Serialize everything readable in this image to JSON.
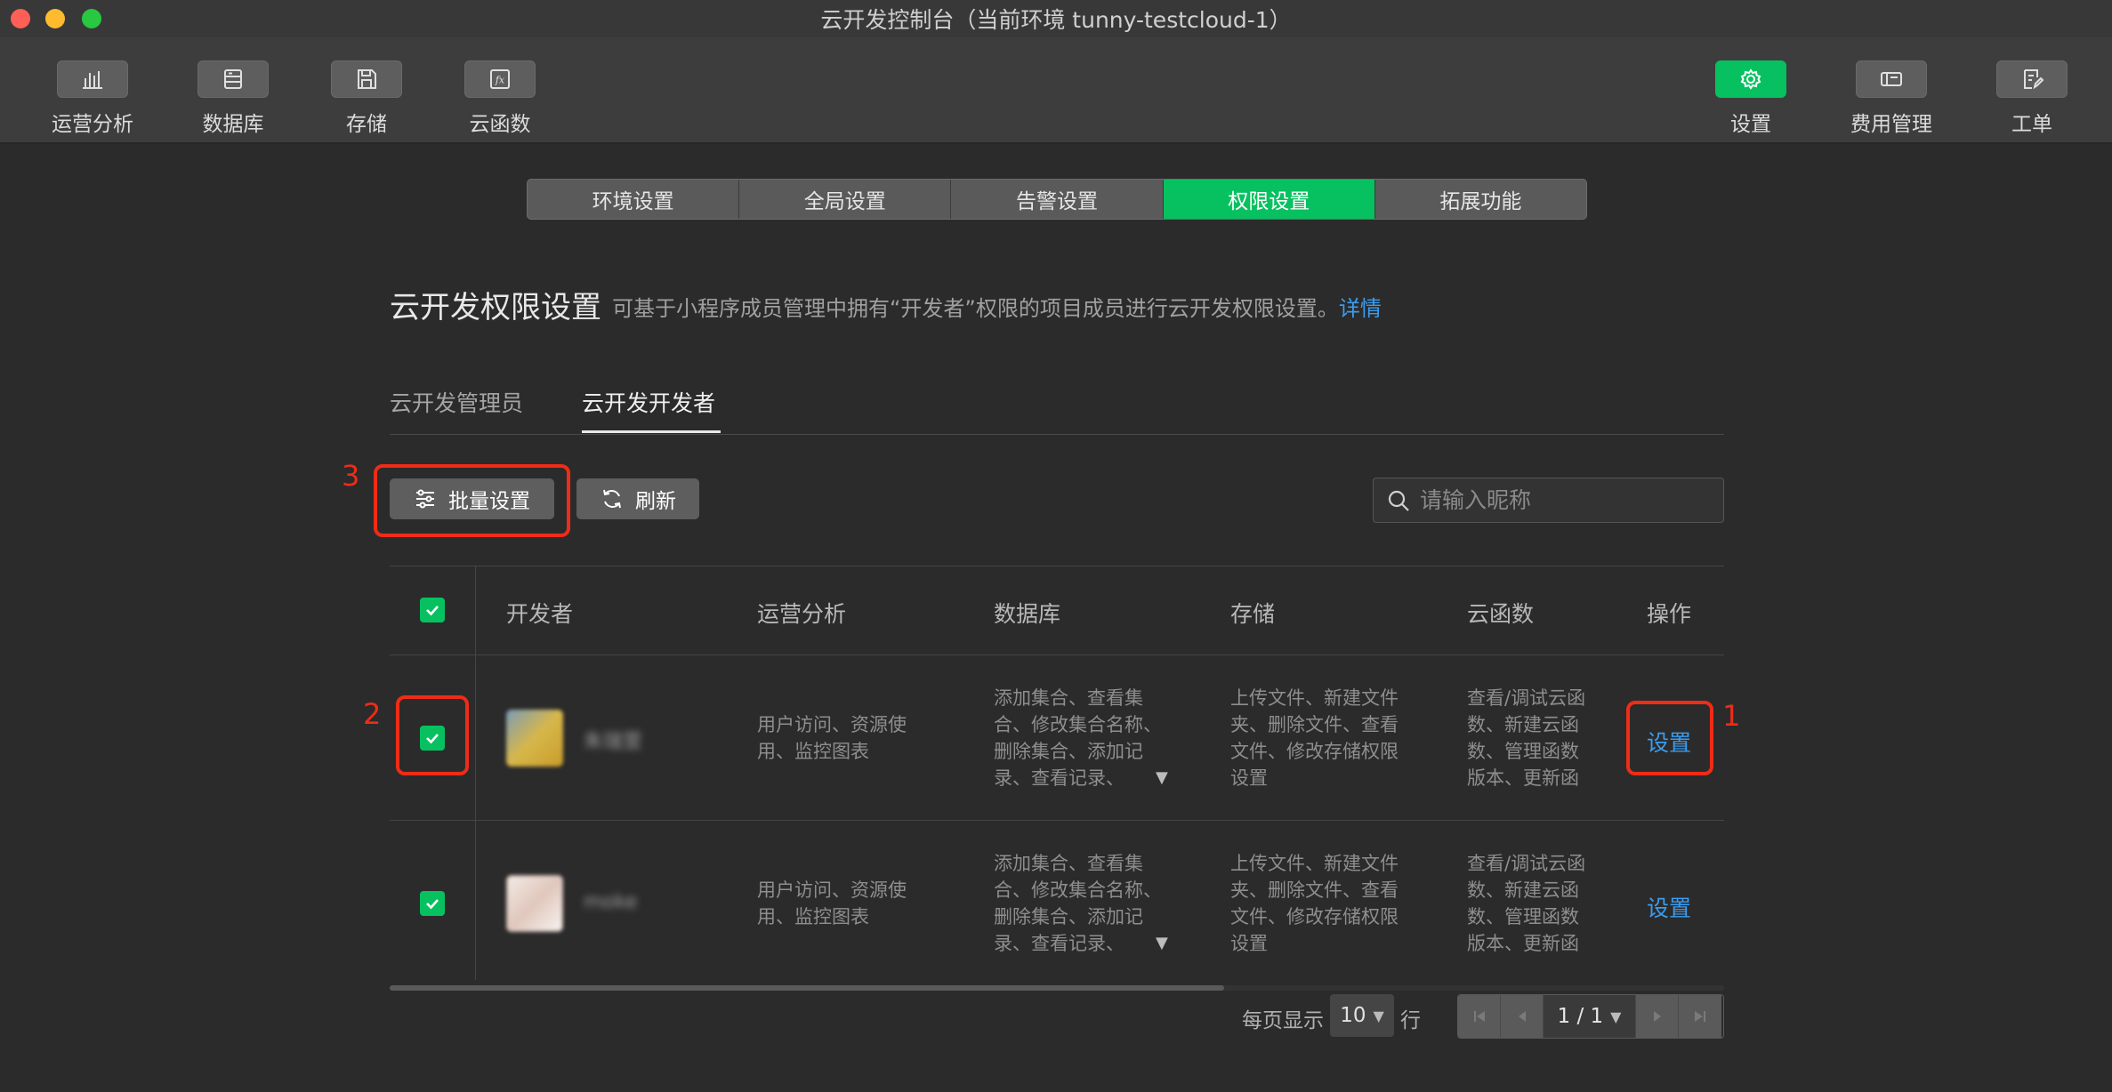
{
  "window": {
    "title": "云开发控制台（当前环境 tunny-testcloud-1）"
  },
  "toolbar": {
    "left": [
      {
        "label": "运营分析",
        "icon": "bar-chart-icon"
      },
      {
        "label": "数据库",
        "icon": "database-icon"
      },
      {
        "label": "存储",
        "icon": "storage-icon"
      },
      {
        "label": "云函数",
        "icon": "function-icon"
      }
    ],
    "right": [
      {
        "label": "设置",
        "icon": "gear-icon",
        "active": true
      },
      {
        "label": "费用管理",
        "icon": "billing-icon"
      },
      {
        "label": "工单",
        "icon": "ticket-icon"
      }
    ]
  },
  "settings_tabs": [
    "环境设置",
    "全局设置",
    "告警设置",
    "权限设置",
    "拓展功能"
  ],
  "settings_tabs_active": "权限设置",
  "page": {
    "title": "云开发权限设置",
    "description": "可基于小程序成员管理中拥有“开发者”权限的项目成员进行云开发权限设置。",
    "detail_link": "详情"
  },
  "sub_tabs": {
    "admin": "云开发管理员",
    "developer": "云开发开发者",
    "active": "云开发开发者"
  },
  "actions": {
    "batch": "批量设置",
    "refresh": "刷新"
  },
  "search": {
    "placeholder": "请输入昵称",
    "value": ""
  },
  "table": {
    "columns": [
      "开发者",
      "运营分析",
      "数据库",
      "存储",
      "云函数",
      "操作"
    ],
    "rows": [
      {
        "checked": true,
        "nickname": "朱瑞萱",
        "analytics": "用户访问、资源使用、监控图表",
        "database": "添加集合、查看集合、修改集合名称、删除集合、添加记录、查看记录、",
        "storage": "上传文件、新建文件夹、删除文件、查看文件、修改存储权限设置",
        "functions": "查看/调试云函数、新建云函数、管理函数版本、更新函数、删除云函数",
        "op": "设置"
      },
      {
        "checked": true,
        "nickname": "moke",
        "analytics": "用户访问、资源使用、监控图表",
        "database": "添加集合、查看集合、修改集合名称、删除集合、添加记录、查看记录、",
        "storage": "上传文件、新建文件夹、删除文件、查看文件、修改存储权限设置",
        "functions": "查看/调试云函数、新建云函数、管理函数版本、更新函数、删除云函数",
        "op": "设置"
      }
    ]
  },
  "pagination": {
    "per_page_label": "每页显示",
    "per_page": "10",
    "rows_label": "行",
    "page": "1 / 1"
  },
  "annotations": [
    "1",
    "2",
    "3"
  ],
  "colors": {
    "accent": "#07c160",
    "link": "#3b9cf0",
    "annotation": "#ef2c16"
  }
}
